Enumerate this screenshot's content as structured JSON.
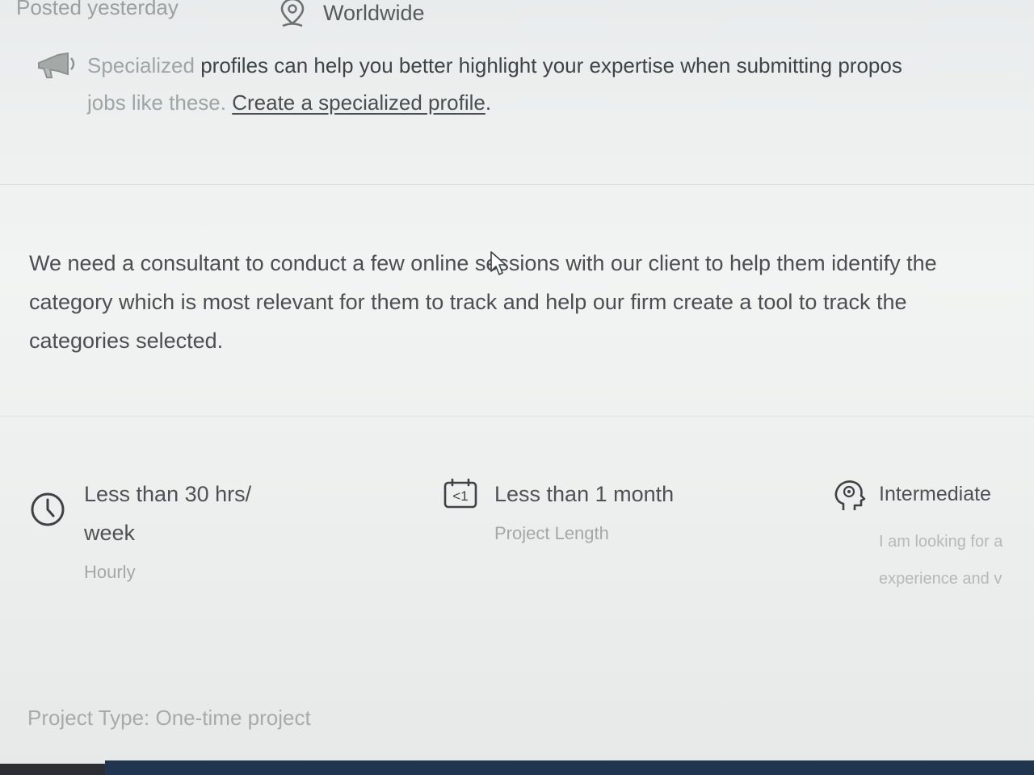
{
  "meta": {
    "posted": "Posted yesterday",
    "location": "Worldwide",
    "location_icon": "map-pin-icon"
  },
  "notice": {
    "icon": "megaphone-icon",
    "line1_faded": "Specialized",
    "line1_rest": " profiles can help you better highlight your expertise when submitting propos",
    "line2_faded": "jobs like these. ",
    "link": "Create a specialized profile",
    "line2_end": "."
  },
  "description": {
    "line1": "We need a consultant to conduct a few online sessions with our client to help them identify the",
    "line2": "category which is most relevant for them to track and help our firm create a tool to track the",
    "line3": "categories selected."
  },
  "features": {
    "hours": {
      "icon": "clock-icon",
      "title_line1": "Less than 30 hrs/",
      "title_line2": "week",
      "subtitle": "Hourly"
    },
    "length": {
      "icon": "calendar-icon",
      "icon_label": "<1",
      "title": "Less than 1 month",
      "subtitle": "Project Length"
    },
    "level": {
      "icon": "brain-icon",
      "title": "Intermediate",
      "subtitle_line1": "I am looking for a",
      "subtitle_line2": "experience and v"
    }
  },
  "project_type": "Project Type: One-time project",
  "colors": {
    "background": "#eef0ef",
    "text": "#4a4f51",
    "muted": "#a3a8a7",
    "taskbar": "#1f3550"
  }
}
